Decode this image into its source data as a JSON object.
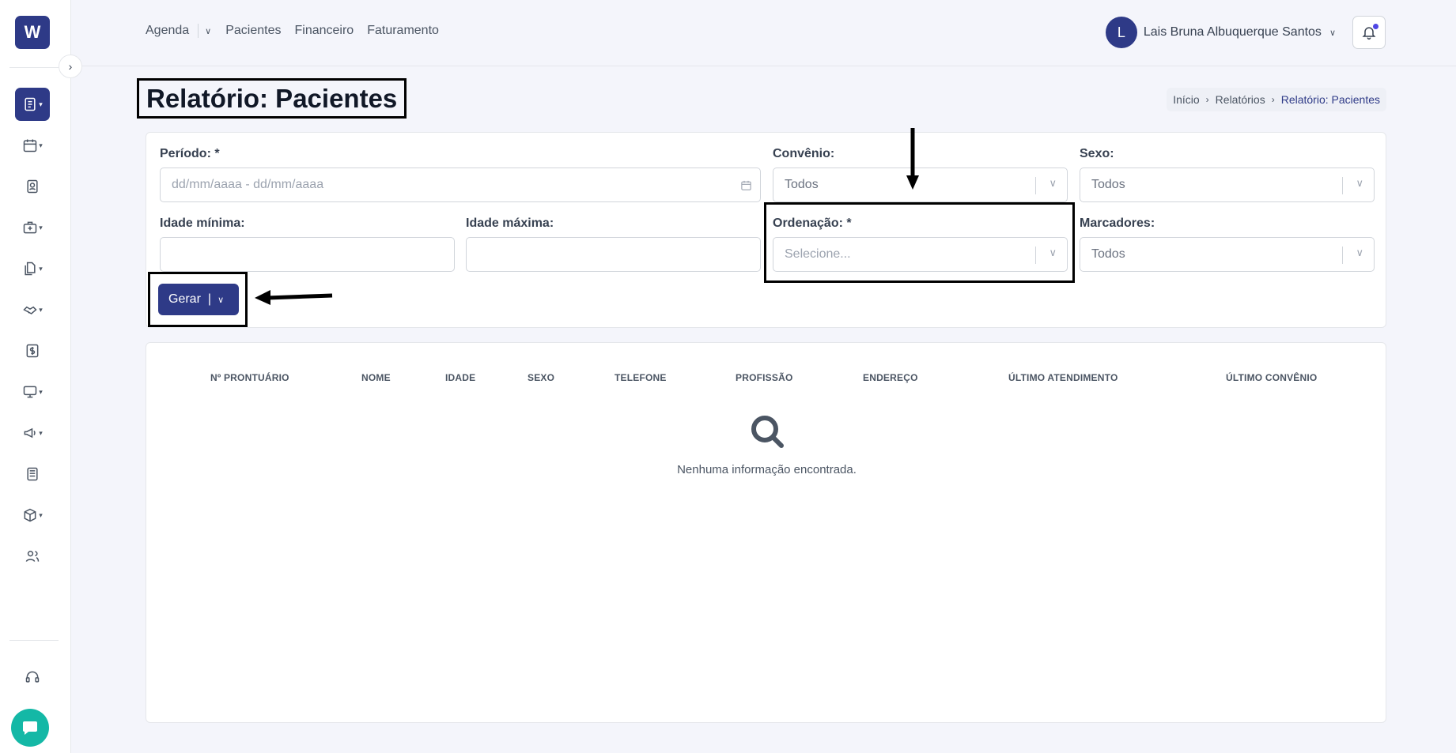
{
  "app": {
    "logo_letter": "W"
  },
  "nav": {
    "agenda": "Agenda",
    "pacientes": "Pacientes",
    "financeiro": "Financeiro",
    "faturamento": "Faturamento"
  },
  "user": {
    "initial": "L",
    "name": "Lais Bruna Albuquerque Santos"
  },
  "page": {
    "title": "Relatório: Pacientes"
  },
  "breadcrumb": {
    "inicio": "Início",
    "relatorios": "Relatórios",
    "current": "Relatório: Pacientes"
  },
  "filters": {
    "periodo_label": "Período: *",
    "periodo_placeholder": "dd/mm/aaaa - dd/mm/aaaa",
    "convenio_label": "Convênio:",
    "convenio_value": "Todos",
    "sexo_label": "Sexo:",
    "sexo_value": "Todos",
    "idade_min_label": "Idade mínima:",
    "idade_max_label": "Idade máxima:",
    "ordenacao_label": "Ordenação: *",
    "ordenacao_placeholder": "Selecione...",
    "marcadores_label": "Marcadores:",
    "marcadores_value": "Todos"
  },
  "actions": {
    "gerar_label": "Gerar"
  },
  "table": {
    "columns": [
      "Nº PRONTUÁRIO",
      "NOME",
      "IDADE",
      "SEXO",
      "TELEFONE",
      "PROFISSÃO",
      "ENDEREÇO",
      "ÚLTIMO ATENDIMENTO",
      "ÚLTIMO CONVÊNIO"
    ],
    "empty_message": "Nenhuma informação encontrada."
  },
  "colors": {
    "primary": "#2e3a87",
    "accent_dot": "#4f46e5",
    "chat": "#14b8a6"
  }
}
